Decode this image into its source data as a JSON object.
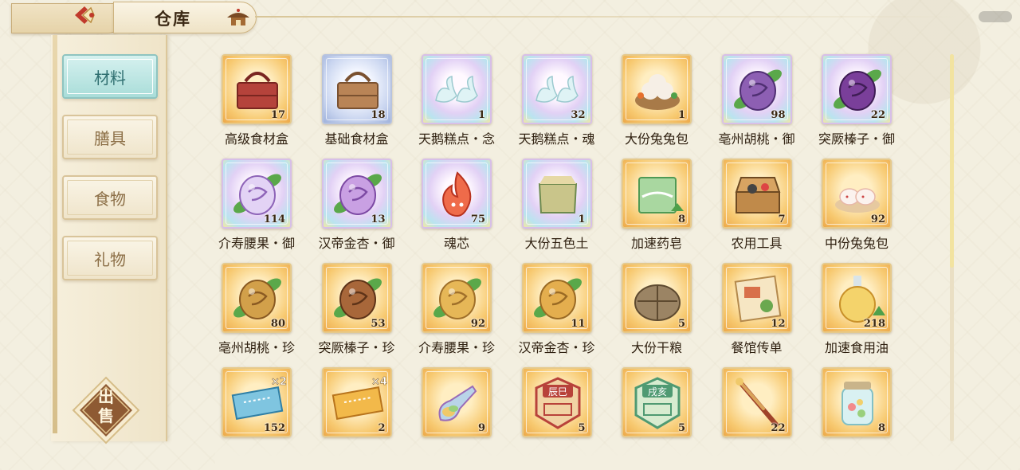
{
  "header": {
    "title": "仓库"
  },
  "sidebar": {
    "tabs": [
      {
        "label": "材料",
        "active": true
      },
      {
        "label": "膳具",
        "active": false
      },
      {
        "label": "食物",
        "active": false
      },
      {
        "label": "礼物",
        "active": false
      }
    ],
    "sell_label_line1": "出",
    "sell_label_line2": "售"
  },
  "items": [
    {
      "name": "高级食材盒",
      "qty": "17",
      "frame": "gold",
      "icon": "red-food-basket-icon"
    },
    {
      "name": "基础食材盒",
      "qty": "18",
      "frame": "blue",
      "icon": "wooden-food-basket-icon"
    },
    {
      "name": "天鹅糕点・念",
      "qty": "1",
      "frame": "purple",
      "icon": "swan-pastry-icon"
    },
    {
      "name": "天鹅糕点・魂",
      "qty": "32",
      "frame": "purple",
      "icon": "swan-pastry-icon"
    },
    {
      "name": "大份兔兔包",
      "qty": "1",
      "frame": "gold",
      "icon": "bunny-bun-steamer-icon"
    },
    {
      "name": "亳州胡桃・御",
      "qty": "98",
      "frame": "purple",
      "icon": "purple-walnut-icon"
    },
    {
      "name": "突厥榛子・御",
      "qty": "22",
      "frame": "purple",
      "icon": "purple-hazelnut-icon"
    },
    {
      "name": "介寿腰果・御",
      "qty": "114",
      "frame": "purple",
      "icon": "purple-cashew-icon"
    },
    {
      "name": "汉帝金杏・御",
      "qty": "13",
      "frame": "purple",
      "icon": "purple-apricot-icon"
    },
    {
      "name": "魂芯",
      "qty": "75",
      "frame": "purple",
      "icon": "flame-soul-core-icon"
    },
    {
      "name": "大份五色土",
      "qty": "1",
      "frame": "purple",
      "icon": "five-color-soil-icon"
    },
    {
      "name": "加速药皂",
      "qty": "8",
      "frame": "gold",
      "icon": "green-soap-icon"
    },
    {
      "name": "农用工具",
      "qty": "7",
      "frame": "gold",
      "icon": "tool-box-icon"
    },
    {
      "name": "中份兔兔包",
      "qty": "92",
      "frame": "gold",
      "icon": "bunny-bun-plate-icon"
    },
    {
      "name": "亳州胡桃・珍",
      "qty": "80",
      "frame": "gold",
      "icon": "gold-walnut-icon"
    },
    {
      "name": "突厥榛子・珍",
      "qty": "53",
      "frame": "gold",
      "icon": "gold-hazelnut-icon"
    },
    {
      "name": "介寿腰果・珍",
      "qty": "92",
      "frame": "gold",
      "icon": "gold-cashew-icon"
    },
    {
      "name": "汉帝金杏・珍",
      "qty": "11",
      "frame": "gold",
      "icon": "gold-apricot-icon"
    },
    {
      "name": "大份干粮",
      "qty": "5",
      "frame": "gold",
      "icon": "ration-sack-icon"
    },
    {
      "name": "餐馆传单",
      "qty": "12",
      "frame": "gold",
      "icon": "restaurant-flyer-icon"
    },
    {
      "name": "加速食用油",
      "qty": "218",
      "frame": "gold",
      "icon": "oil-flask-icon"
    },
    {
      "name": "",
      "qty": "152",
      "frame": "gold",
      "icon": "blue-ticket-x2-icon",
      "badge": "×2"
    },
    {
      "name": "",
      "qty": "2",
      "frame": "gold",
      "icon": "gold-ticket-x4-icon",
      "badge": "×4"
    },
    {
      "name": "",
      "qty": "9",
      "frame": "gold",
      "icon": "rainbow-scoop-icon"
    },
    {
      "name": "",
      "qty": "5",
      "frame": "gold",
      "icon": "red-shop-token-icon",
      "badge": "辰巳"
    },
    {
      "name": "",
      "qty": "5",
      "frame": "gold",
      "icon": "green-shop-token-icon",
      "badge": "戌亥"
    },
    {
      "name": "",
      "qty": "22",
      "frame": "gold",
      "icon": "brush-pen-icon"
    },
    {
      "name": "",
      "qty": "8",
      "frame": "gold",
      "icon": "candy-jar-icon"
    }
  ]
}
